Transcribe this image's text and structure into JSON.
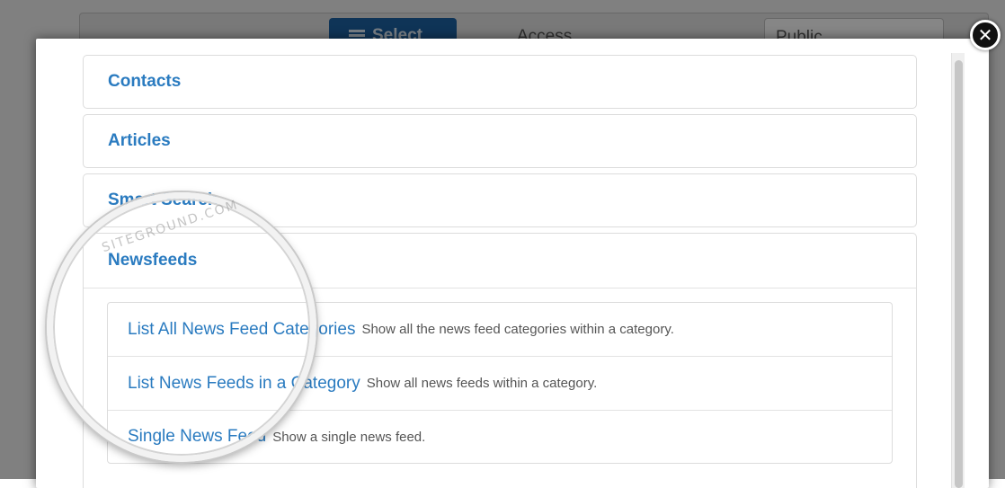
{
  "background": {
    "select_button_label": "Select",
    "access_label": "Access",
    "access_value": "Public"
  },
  "modal": {
    "close_icon": "close-icon",
    "sections": [
      {
        "label": "Contacts"
      },
      {
        "label": "Articles"
      },
      {
        "label": "Smart Search"
      },
      {
        "label": "Newsfeeds"
      }
    ],
    "newsfeeds_items": [
      {
        "link": "List All News Feed Categories",
        "description": "Show all the news feed categories within a category."
      },
      {
        "link": "List News Feeds in a Category",
        "description": "Show all news feeds within a category."
      },
      {
        "link": "Single News Feed",
        "description": "Show a single news feed."
      }
    ]
  },
  "watermark": "SITEGROUND.COM",
  "colors": {
    "link": "#2a7bc0",
    "select_button": "#1d5f9e",
    "overlay": "rgba(0,0,0,0.45)"
  }
}
